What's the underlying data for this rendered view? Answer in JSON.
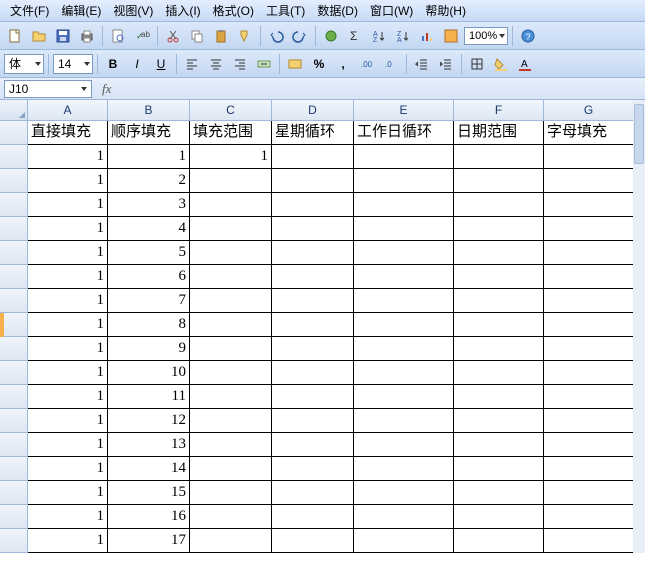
{
  "menu": {
    "file": "文件(F)",
    "edit": "编辑(E)",
    "view": "视图(V)",
    "insert": "插入(I)",
    "format": "格式(O)",
    "tools": "工具(T)",
    "data": "数据(D)",
    "window": "窗口(W)",
    "help": "帮助(H)"
  },
  "toolbar": {
    "zoom": "100%"
  },
  "format": {
    "fontName": "体",
    "fontSize": "14"
  },
  "nameBox": {
    "cellRef": "J10",
    "fx": "fx"
  },
  "columns": [
    "A",
    "B",
    "C",
    "D",
    "E",
    "F",
    "G"
  ],
  "rowCount": 18,
  "header": {
    "A": "直接填充",
    "B": "顺序填充",
    "C": "填充范围",
    "D": "星期循环",
    "E": "工作日循环",
    "F": "日期范围",
    "G": "字母填充"
  },
  "data": {
    "A": [
      "1",
      "1",
      "1",
      "1",
      "1",
      "1",
      "1",
      "1",
      "1",
      "1",
      "1",
      "1",
      "1",
      "1",
      "1",
      "1",
      "1"
    ],
    "B": [
      "1",
      "2",
      "3",
      "4",
      "5",
      "6",
      "7",
      "8",
      "9",
      "10",
      "11",
      "12",
      "13",
      "14",
      "15",
      "16",
      "17"
    ],
    "C": [
      "1",
      "",
      "",
      "",
      "",
      "",
      "",
      "",
      "",
      "",
      "",
      "",
      "",
      "",
      "",
      "",
      ""
    ]
  },
  "markerRow": 9
}
